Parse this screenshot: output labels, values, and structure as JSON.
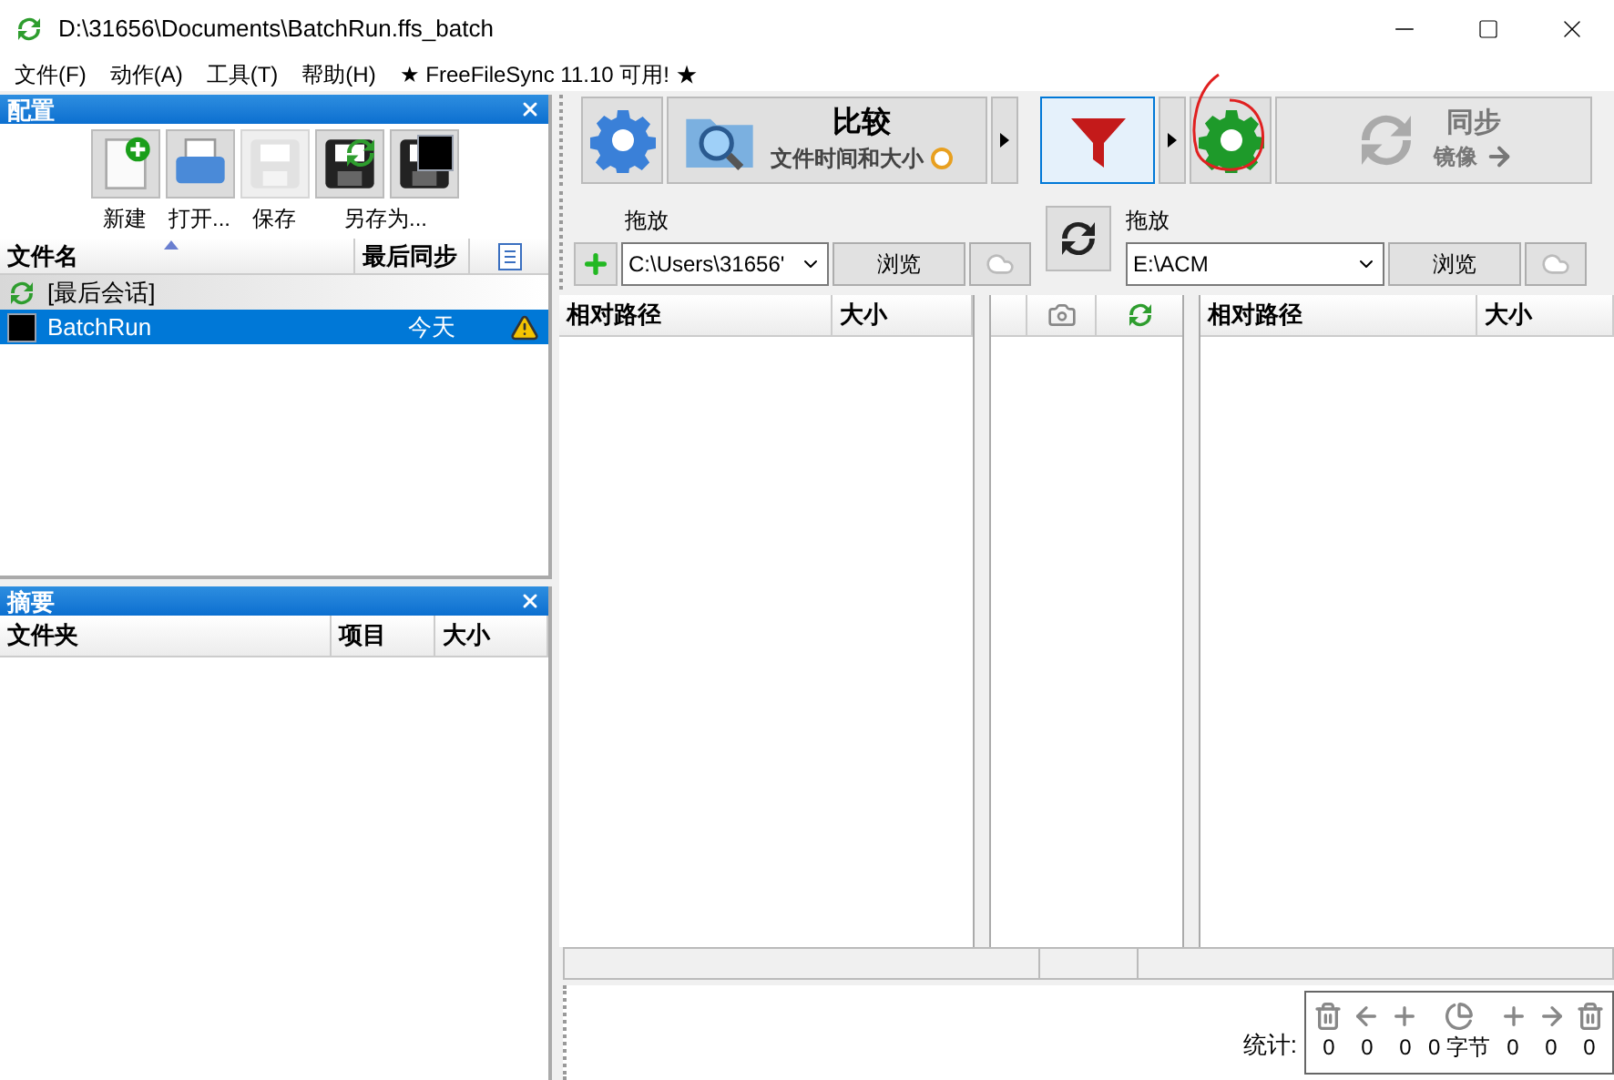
{
  "window": {
    "title": "D:\\31656\\Documents\\BatchRun.ffs_batch"
  },
  "menu": [
    {
      "label": "文件(F)"
    },
    {
      "label": "动作(A)"
    },
    {
      "label": "工具(T)"
    },
    {
      "label": "帮助(H)"
    }
  ],
  "update_notice": "★ FreeFileSync 11.10 可用! ★",
  "config_panel": {
    "title": "配置",
    "tools": [
      {
        "kind": "new",
        "label": "新建",
        "disabled": false
      },
      {
        "kind": "open",
        "label": "打开...",
        "disabled": false
      },
      {
        "kind": "save",
        "label": "保存",
        "disabled": true
      },
      {
        "kind": "saveas",
        "label": "另存为...",
        "disabled": false
      },
      {
        "kind": "saveasbatch",
        "disabled": false
      }
    ],
    "columns": [
      "文件名",
      "最后同步"
    ],
    "rows": [
      {
        "kind": "session",
        "name": "[最后会话]",
        "selected": false
      },
      {
        "kind": "batch",
        "name": "BatchRun",
        "last_sync": "今天",
        "warning": true,
        "selected": true
      }
    ]
  },
  "summary_panel": {
    "title": "摘要",
    "columns": [
      "文件夹",
      "项目",
      "大小"
    ]
  },
  "toolbar": {
    "compare_title": "比较",
    "compare_subtitle": "文件时间和大小",
    "filter_active": true,
    "sync_title": "同步",
    "sync_subtitle": "镜像",
    "sync_disabled": true
  },
  "folders": [
    {
      "drop_label": "拖放",
      "path": "C:\\Users\\31656'",
      "browse": "浏览"
    },
    {
      "drop_label": "拖放",
      "path": "E:\\ACM",
      "browse": "浏览"
    }
  ],
  "grid_left": {
    "columns": [
      "相对路径",
      "大小"
    ]
  },
  "grid_right": {
    "columns": [
      "相对路径",
      "大小"
    ]
  },
  "stats": {
    "label": "统计:",
    "values": [
      {
        "kind": "delete_left",
        "value": "0"
      },
      {
        "kind": "update_left",
        "value": "0"
      },
      {
        "kind": "create_left",
        "value": "0"
      },
      {
        "kind": "bytes",
        "value": "0 字节"
      },
      {
        "kind": "create_right",
        "value": "0"
      },
      {
        "kind": "update_right",
        "value": "0"
      },
      {
        "kind": "delete_right",
        "value": "0"
      }
    ]
  }
}
